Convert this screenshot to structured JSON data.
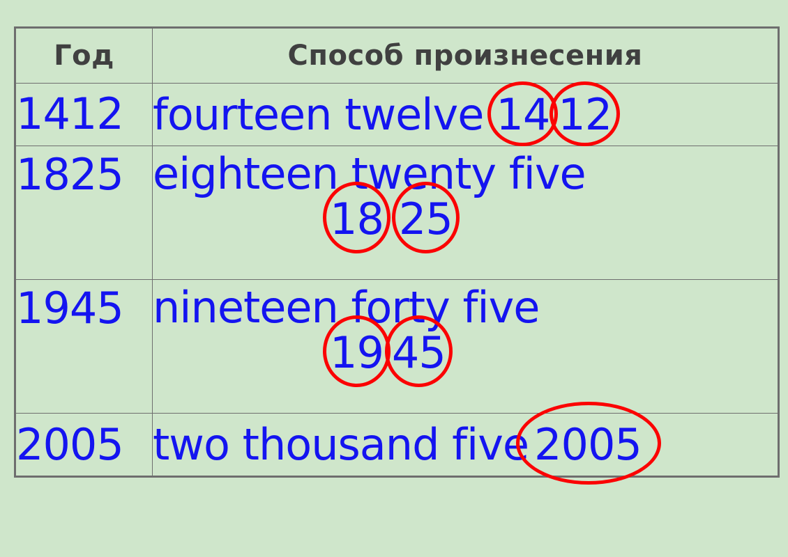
{
  "page": {
    "background_color": "#cfe6cb",
    "text_color_blue": "#1414f0",
    "header_text_color": "#404040",
    "annotation_color": "#fb0303",
    "border_color": "#6e6e6e"
  },
  "table": {
    "headers": {
      "year": "Год",
      "pronunciation": "Способ произнесения"
    },
    "rows": [
      {
        "year": "1412",
        "line1_words": "fourteen twelve",
        "line1_circles": [
          "14",
          "12"
        ],
        "line2_words": "",
        "line2_circles": [],
        "layout": "single-line"
      },
      {
        "year": "1825",
        "line1_words": "eighteen twenty five",
        "line1_circles": [],
        "line2_words": "",
        "line2_circles": [
          "18",
          "25"
        ],
        "layout": "two-line"
      },
      {
        "year": "1945",
        "line1_words": "nineteen forty five",
        "line1_circles": [],
        "line2_words": "",
        "line2_circles": [
          "19",
          "45"
        ],
        "layout": "two-line"
      },
      {
        "year": "2005",
        "line1_words": "two thousand five",
        "line1_circles": [
          "2005"
        ],
        "line2_words": "",
        "line2_circles": [],
        "layout": "single-line"
      }
    ]
  }
}
